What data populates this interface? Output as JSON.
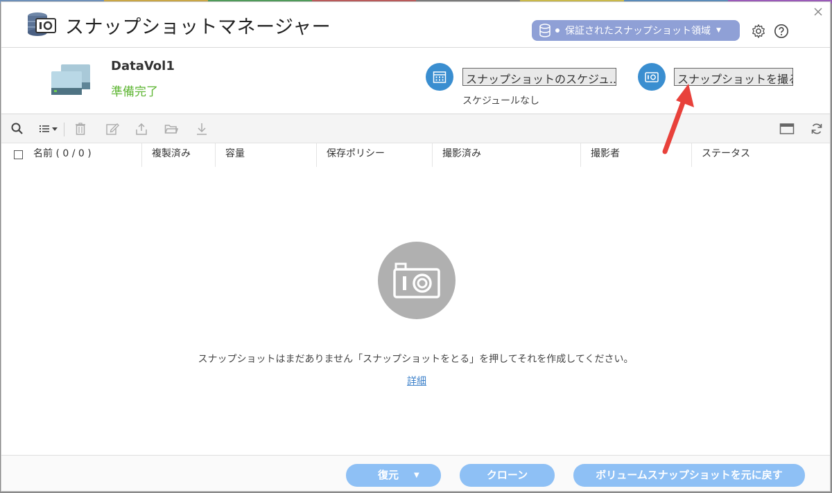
{
  "window": {
    "title": "スナップショットマネージャー",
    "guaranteed_space_label": "保証されたスナップショット領域"
  },
  "volume": {
    "name": "DataVol1",
    "status": "準備完了",
    "schedule_button": "スナップショットのスケジュ...",
    "schedule_status": "スケジュールなし",
    "take_snapshot_button": "スナップショットを撮る"
  },
  "toolbar": {
    "icons": [
      "search-icon",
      "list-view-icon",
      "delete-icon",
      "edit-icon",
      "export-icon",
      "folder-icon",
      "download-icon",
      "window-icon",
      "refresh-icon"
    ]
  },
  "table": {
    "columns": [
      "名前 ( 0 / 0 )",
      "複製済み",
      "容量",
      "保存ポリシー",
      "撮影済み",
      "撮影者",
      "ステータス"
    ]
  },
  "empty_state": {
    "message": "スナップショットはまだありません「スナップショットをとる」を押してそれを作成してください。",
    "details_link": "詳細"
  },
  "footer": {
    "restore_button": "復元",
    "clone_button": "クローン",
    "revert_button": "ボリュームスナップショットを元に戻す"
  },
  "colors": {
    "accent": "#3a8ed0",
    "ready_status": "#5cb531",
    "footer_button": "#8ec0f5",
    "guard_button": "#8fa0d6",
    "annotation_arrow": "#e8413b"
  }
}
